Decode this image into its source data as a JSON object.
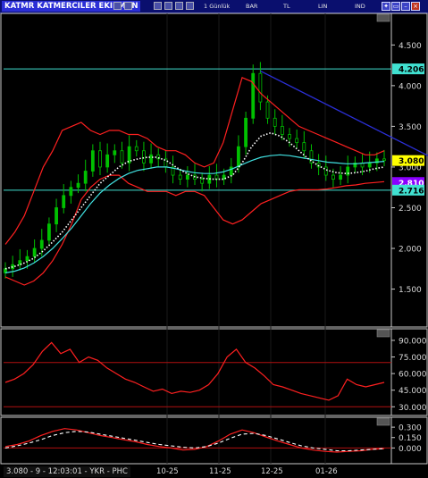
{
  "window": {
    "title": "KATMR KATMERCILER EKIPMAN",
    "toolbar": {
      "period": "1 Günlük",
      "buttons": [
        "BAR",
        "TL",
        "LIN",
        "IND"
      ]
    }
  },
  "status": {
    "text": "3.080 - 9 - 12:03:01 - YKR - PHC"
  },
  "colors": {
    "price_candles": "#00c000",
    "bollinger": "#ff2020",
    "ma_dotted": "#ffffff",
    "ma_cyan": "#40e0e0",
    "trendline": "#2b2fd6",
    "hline": "#40e0d0",
    "rsi": "#ff2020",
    "macd": "#ff2020",
    "signal": "#ffffff",
    "last_price_tag": "#ffff00",
    "ma_tag": "#8a00ff"
  },
  "chart_data": [
    {
      "type": "line",
      "panel": "price",
      "y_ticks": [
        "4.500",
        "4.000",
        "3.500",
        "3.000",
        "2.500",
        "2.000",
        "1.500"
      ],
      "ylim": [
        1.1,
        4.8
      ],
      "x_ticks": [
        "10-25",
        "11-25",
        "12-25",
        "01-26"
      ],
      "horizontal_lines": [
        4.206,
        2.716
      ],
      "price_tags": [
        {
          "label": "4.206",
          "value": 4.206,
          "kind": "hline"
        },
        {
          "label": "3.080",
          "value": 3.08,
          "kind": "last"
        },
        {
          "label": "2.810",
          "value": 2.81,
          "kind": "ma"
        },
        {
          "label": "2.716",
          "value": 2.716,
          "kind": "hline"
        }
      ],
      "close": [
        1.75,
        1.8,
        1.85,
        1.9,
        2.0,
        2.1,
        2.3,
        2.5,
        2.65,
        2.75,
        2.8,
        2.95,
        3.2,
        3.0,
        3.15,
        3.2,
        3.05,
        3.25,
        3.2,
        3.05,
        3.15,
        3.1,
        3.0,
        2.9,
        2.85,
        2.9,
        2.85,
        2.8,
        2.9,
        2.85,
        2.9,
        3.0,
        3.25,
        3.6,
        4.15,
        3.8,
        3.6,
        3.5,
        3.4,
        3.35,
        3.3,
        3.2,
        3.05,
        3.0,
        2.9,
        2.85,
        2.9,
        3.0,
        3.05,
        3.0,
        3.05,
        3.1,
        3.08
      ],
      "bollinger_upper": [
        2.05,
        2.2,
        2.4,
        2.7,
        3.0,
        3.2,
        3.45,
        3.5,
        3.55,
        3.45,
        3.4,
        3.45,
        3.45,
        3.4,
        3.4,
        3.35,
        3.25,
        3.2,
        3.2,
        3.15,
        3.05,
        3.0,
        3.05,
        3.3,
        3.7,
        4.1,
        4.05,
        3.9,
        3.8,
        3.7,
        3.6,
        3.5,
        3.45,
        3.4,
        3.35,
        3.3,
        3.25,
        3.2,
        3.15,
        3.15,
        3.2
      ],
      "bollinger_lower": [
        1.65,
        1.6,
        1.55,
        1.6,
        1.7,
        1.85,
        2.05,
        2.3,
        2.6,
        2.75,
        2.85,
        2.9,
        2.9,
        2.8,
        2.75,
        2.7,
        2.7,
        2.7,
        2.65,
        2.7,
        2.7,
        2.65,
        2.5,
        2.35,
        2.3,
        2.35,
        2.45,
        2.55,
        2.6,
        2.65,
        2.7,
        2.72,
        2.72,
        2.72,
        2.73,
        2.75,
        2.77,
        2.78,
        2.8,
        2.81,
        2.82
      ],
      "ma_dotted": [
        1.75,
        1.78,
        1.82,
        1.88,
        1.97,
        2.08,
        2.2,
        2.35,
        2.5,
        2.65,
        2.8,
        2.9,
        3.0,
        3.07,
        3.1,
        3.12,
        3.12,
        3.08,
        3.0,
        2.93,
        2.88,
        2.86,
        2.85,
        2.85,
        2.9,
        3.05,
        3.25,
        3.38,
        3.42,
        3.38,
        3.3,
        3.2,
        3.1,
        3.02,
        2.96,
        2.93,
        2.92,
        2.93,
        2.95,
        2.98,
        3.0
      ],
      "ma_cyan": [
        1.7,
        1.72,
        1.76,
        1.82,
        1.9,
        2.0,
        2.12,
        2.25,
        2.4,
        2.55,
        2.68,
        2.78,
        2.86,
        2.92,
        2.96,
        2.98,
        3.0,
        3.0,
        2.98,
        2.95,
        2.93,
        2.92,
        2.92,
        2.94,
        2.98,
        3.03,
        3.08,
        3.12,
        3.14,
        3.15,
        3.14,
        3.12,
        3.1,
        3.08,
        3.06,
        3.05,
        3.04,
        3.04,
        3.05,
        3.06,
        3.07
      ],
      "trendline": [
        [
          35,
          4.18
        ],
        [
          58,
          3.14
        ]
      ]
    },
    {
      "type": "line",
      "panel": "rsi",
      "y_ticks": [
        "90.000",
        "75.000",
        "60.000",
        "45.000",
        "30.000"
      ],
      "ylim": [
        27,
        94
      ],
      "horizontal_lines": [
        70,
        30
      ],
      "values": [
        52,
        55,
        60,
        68,
        80,
        88,
        78,
        82,
        70,
        75,
        72,
        65,
        60,
        55,
        52,
        48,
        44,
        46,
        42,
        44,
        43,
        45,
        50,
        60,
        75,
        82,
        70,
        65,
        58,
        50,
        48,
        45,
        42,
        40,
        38,
        36,
        40,
        55,
        50,
        48,
        50,
        52
      ]
    },
    {
      "type": "line",
      "panel": "macd",
      "y_ticks": [
        "0.300",
        "0.150",
        "0.000"
      ],
      "ylim": [
        -0.15,
        0.34
      ],
      "macd": [
        0.02,
        0.05,
        0.1,
        0.18,
        0.24,
        0.28,
        0.26,
        0.22,
        0.18,
        0.15,
        0.12,
        0.09,
        0.05,
        0.02,
        0.0,
        -0.03,
        -0.02,
        0.02,
        0.1,
        0.2,
        0.26,
        0.22,
        0.16,
        0.1,
        0.05,
        0.0,
        -0.03,
        -0.05,
        -0.06,
        -0.05,
        -0.04,
        -0.02,
        -0.01
      ],
      "signal": [
        0.0,
        0.03,
        0.07,
        0.12,
        0.18,
        0.22,
        0.24,
        0.23,
        0.2,
        0.17,
        0.14,
        0.11,
        0.08,
        0.05,
        0.03,
        0.01,
        0.0,
        0.02,
        0.07,
        0.14,
        0.2,
        0.21,
        0.18,
        0.13,
        0.08,
        0.03,
        0.0,
        -0.02,
        -0.04,
        -0.04,
        -0.03,
        -0.02,
        -0.01
      ]
    }
  ]
}
